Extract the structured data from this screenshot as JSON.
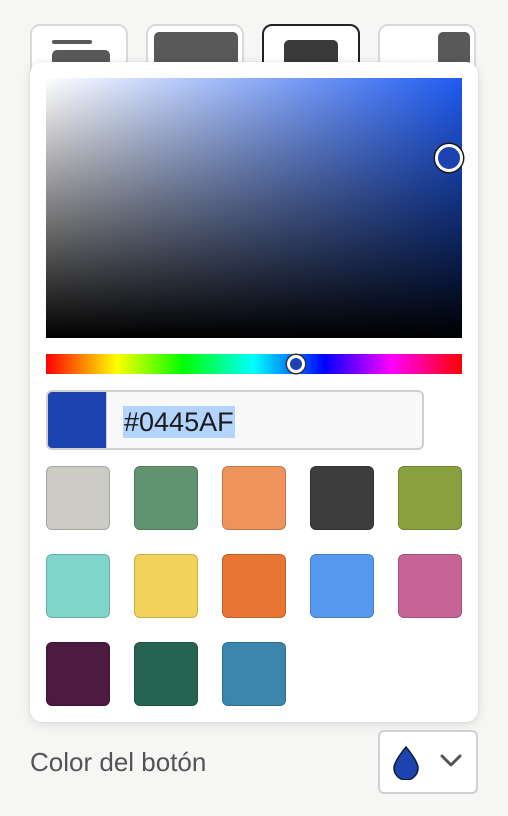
{
  "style_buttons": [
    {
      "name": "style-option-1",
      "selected": false
    },
    {
      "name": "style-option-2",
      "selected": false
    },
    {
      "name": "style-option-3",
      "selected": true
    },
    {
      "name": "style-option-4",
      "selected": false
    }
  ],
  "color_picker": {
    "hex_value": "#0445AF",
    "selected_color": "#1D43B1",
    "hue_color": "#1F5BF2",
    "swatches": [
      {
        "name": "light-gray",
        "color": "#CCCCC5"
      },
      {
        "name": "green",
        "color": "#629370"
      },
      {
        "name": "light-orange",
        "color": "#EE935C"
      },
      {
        "name": "dark-gray",
        "color": "#3D3D3D"
      },
      {
        "name": "olive",
        "color": "#89A13E"
      },
      {
        "name": "teal",
        "color": "#7FD5C9"
      },
      {
        "name": "yellow",
        "color": "#F2D25A"
      },
      {
        "name": "orange",
        "color": "#E97632"
      },
      {
        "name": "blue",
        "color": "#5699F1"
      },
      {
        "name": "pink",
        "color": "#C66595"
      },
      {
        "name": "plum",
        "color": "#4D1A42"
      },
      {
        "name": "dark-green",
        "color": "#266353"
      },
      {
        "name": "steel-blue",
        "color": "#3A86AD"
      }
    ]
  },
  "footer": {
    "label": "Color del botón",
    "button_icon": "water-drop-icon",
    "dropdown_icon": "chevron-down-icon",
    "drop_color": "#1D43B1"
  }
}
